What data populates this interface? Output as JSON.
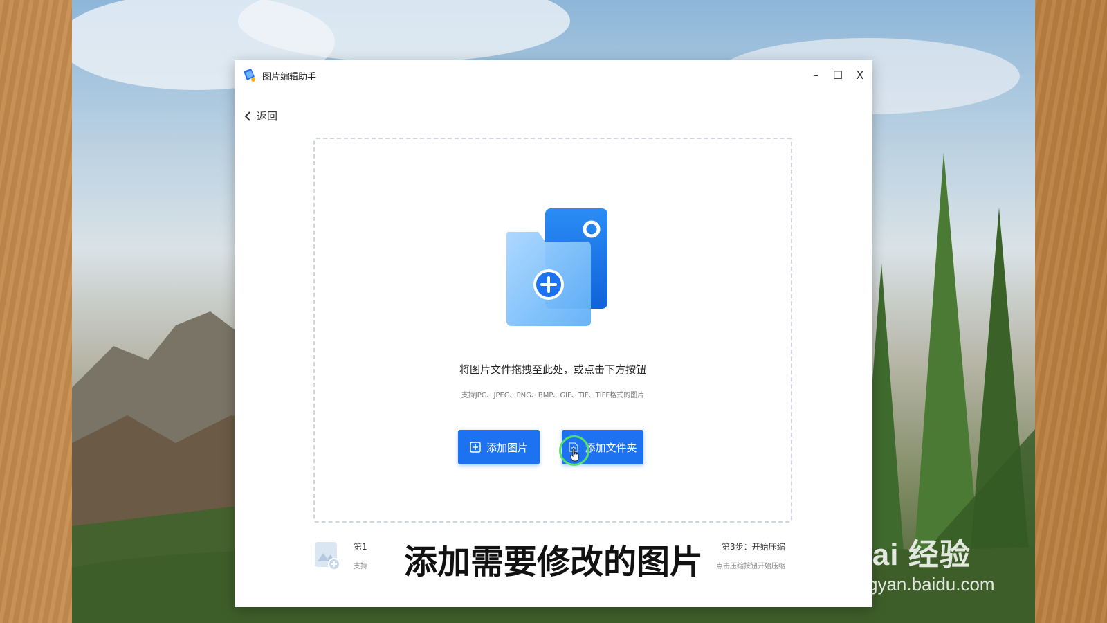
{
  "window": {
    "title": "图片编辑助手",
    "controls": {
      "minimize": "–",
      "maximize": "☐",
      "close": "X"
    }
  },
  "nav": {
    "back_label": "返回"
  },
  "dropzone": {
    "hint": "将图片文件拖拽至此处，或点击下方按钮",
    "formats": "支持JPG、JPEG、PNG、BMP、GIF、TIF、TIFF格式的图片"
  },
  "buttons": {
    "add_image": "添加图片",
    "add_folder": "添加文件夹"
  },
  "steps": {
    "step1_label": "第1",
    "step1_sub": "支持",
    "step3_label": "第3步：开始压缩",
    "step3_sub": "点击压缩按钮开始压缩"
  },
  "overlay": {
    "caption": "添加需要修改的图片",
    "watermark_main": "Bai 经验",
    "watermark_url": "jingyan.baidu.com"
  },
  "colors": {
    "accent": "#1c72f0",
    "click_ring": "#57e06a",
    "window_bg": "#ffffff"
  },
  "icons": {
    "app_logo": "app-logo-icon",
    "back": "chevron-left-icon",
    "illustration": "folder-add-icon",
    "add_image": "plus-square-icon",
    "add_folder": "folder-plus-icon",
    "cursor": "hand-cursor-icon"
  }
}
